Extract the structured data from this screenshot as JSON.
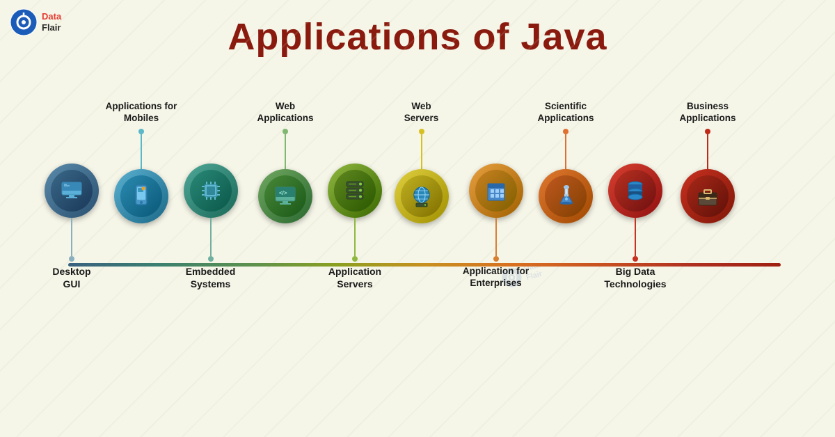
{
  "page": {
    "title": "Applications of Java",
    "background_color": "#f5f5e8"
  },
  "logo": {
    "text_line1": "Data",
    "text_line2": "Flair"
  },
  "nodes": [
    {
      "id": 1,
      "label_position": "bottom",
      "label": "Desktop\nGUI",
      "outer_color": "#3a5f7a",
      "inner_color": "#2a4f6a",
      "icon": "desktop",
      "connector_color": "#6a9ab0"
    },
    {
      "id": 2,
      "label_position": "top",
      "label": "Applications for\nMobiles",
      "outer_color": "#3a7a9a",
      "inner_color": "#2a6a8a",
      "icon": "mobile",
      "connector_color": "#5a9ab0"
    },
    {
      "id": 3,
      "label_position": "bottom",
      "label": "Embedded\nSystems",
      "outer_color": "#3a8a7a",
      "inner_color": "#2a7a6a",
      "icon": "chip",
      "connector_color": "#5ab0a0"
    },
    {
      "id": 4,
      "label_position": "top",
      "label": "Web\nApplications",
      "outer_color": "#4a8a5a",
      "inner_color": "#3a7a4a",
      "icon": "monitor-code",
      "connector_color": "#7ab08a"
    },
    {
      "id": 5,
      "label_position": "bottom",
      "label": "Application\nServers",
      "outer_color": "#5a8a3a",
      "inner_color": "#4a7a2a",
      "icon": "server",
      "connector_color": "#8ab06a"
    },
    {
      "id": 6,
      "label_position": "top",
      "label": "Web\nServers",
      "outer_color": "#c8b820",
      "inner_color": "#b8a810",
      "icon": "globe-server",
      "connector_color": "#d8c840"
    },
    {
      "id": 7,
      "label_position": "bottom",
      "label": "Application for\nEnterprises",
      "outer_color": "#d48020",
      "inner_color": "#c47010",
      "icon": "building",
      "connector_color": "#e49040"
    },
    {
      "id": 8,
      "label_position": "top",
      "label": "Scientific\nApplications",
      "outer_color": "#d06020",
      "inner_color": "#c05010",
      "icon": "microscope",
      "connector_color": "#e07040"
    },
    {
      "id": 9,
      "label_position": "bottom",
      "label": "Big Data\nTechnologies",
      "outer_color": "#c03020",
      "inner_color": "#b02010",
      "icon": "database",
      "connector_color": "#d04030"
    },
    {
      "id": 10,
      "label_position": "top",
      "label": "Business\nApplications",
      "outer_color": "#b02010",
      "inner_color": "#a01000",
      "icon": "briefcase",
      "connector_color": "#c03020"
    }
  ]
}
